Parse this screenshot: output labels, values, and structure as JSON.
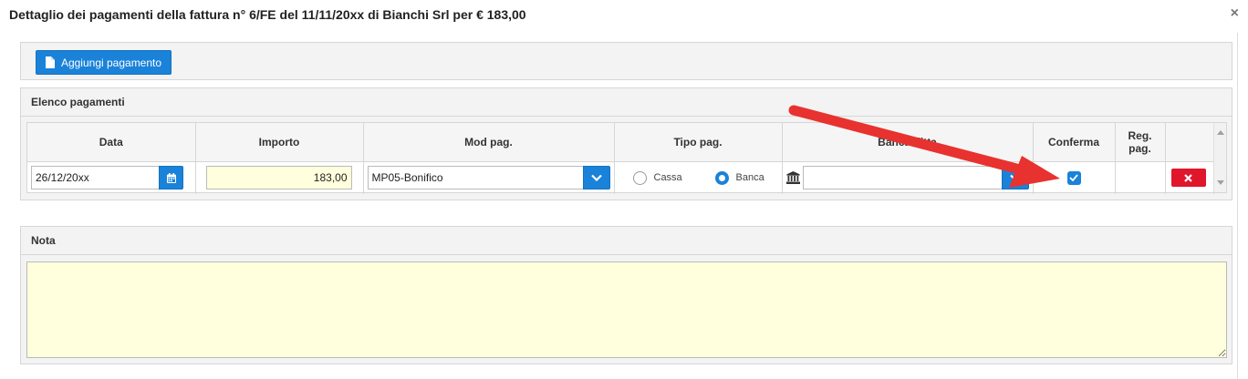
{
  "modal": {
    "title": "Dettaglio dei pagamenti della fattura n° 6/FE del 11/11/20xx di Bianchi Srl per € 183,00",
    "close_symbol": "×"
  },
  "toolbar": {
    "add_label": "Aggiungi pagamento"
  },
  "payments": {
    "header": "Elenco pagamenti",
    "columns": [
      "Data",
      "Importo",
      "Mod pag.",
      "Tipo pag.",
      "Banca ditta",
      "Conferma",
      "Reg. pag.",
      ""
    ],
    "row": {
      "date": "26/12/20xx",
      "amount": "183,00",
      "mod_pag": "MP05-Bonifico",
      "tipo_options": [
        "Cassa",
        "Banca"
      ],
      "tipo_selected": "Banca",
      "banca_ditta": "",
      "conferma": true,
      "reg_pag": "",
      "delete_symbol": "✕"
    }
  },
  "nota": {
    "header": "Nota",
    "value": ""
  },
  "colors": {
    "accent": "#1a82d9",
    "danger": "#e0162b",
    "input_highlight": "#ffffdd",
    "annotation_arrow": "#e8322f"
  }
}
